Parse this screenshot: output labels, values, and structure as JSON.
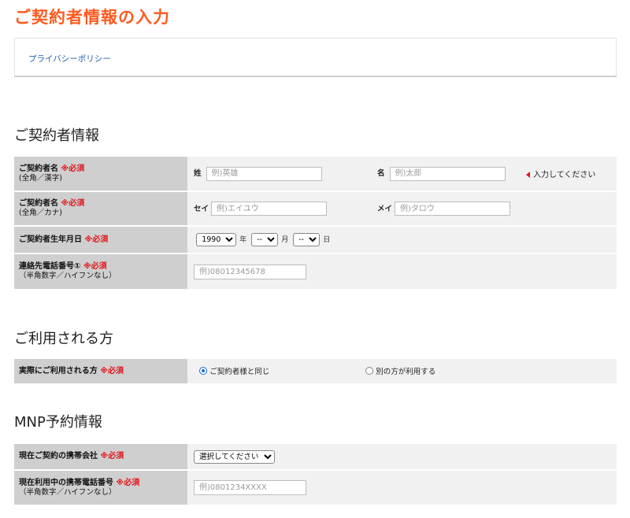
{
  "page_title": "ご契約者情報の入力",
  "privacy_link": "プライバシーポリシー",
  "contractor_section": {
    "title": "ご契約者情報",
    "name_kanji": {
      "label": "ご契約者名",
      "required": "※必須",
      "sub": "(全角／漢字)",
      "last_label": "姓",
      "last_placeholder": "例)英雄",
      "first_label": "名",
      "first_placeholder": "例)太郎",
      "note": "入力してください"
    },
    "name_kana": {
      "label": "ご契約者名",
      "required": "※必須",
      "sub": "(全角／カナ)",
      "last_label": "セイ",
      "last_placeholder": "例)エイユウ",
      "first_label": "メイ",
      "first_placeholder": "例)タロウ"
    },
    "birthdate": {
      "label": "ご契約者生年月日",
      "required": "※必須",
      "year_value": "1990",
      "year_unit": "年",
      "month_value": "--",
      "month_unit": "月",
      "day_value": "--",
      "day_unit": "日"
    },
    "phone": {
      "label": "連絡先電話番号①",
      "required": "※必須",
      "sub": "（半角数字／ハイフンなし）",
      "placeholder": "例)08012345678"
    }
  },
  "user_section": {
    "title": "ご利用される方",
    "label": "実際にご利用される方",
    "required": "※必須",
    "option_same": "ご契約者様と同じ",
    "option_other": "別の方が利用する"
  },
  "mnp_section": {
    "title": "MNP予約情報",
    "carrier": {
      "label": "現在ご契約の携帯会社",
      "required": "※必須",
      "selected": "選択してください"
    },
    "number": {
      "label": "現在利用中の携帯電話番号",
      "required": "※必須",
      "sub": "（半角数字／ハイフンなし）",
      "placeholder": "例)0801234XXXX"
    }
  },
  "colors": {
    "accent": "#ff5a1f",
    "required": "#e0161b",
    "link": "#1a5fb4",
    "label_bg": "#cfcfcf",
    "cell_bg": "#f1f1f1"
  }
}
